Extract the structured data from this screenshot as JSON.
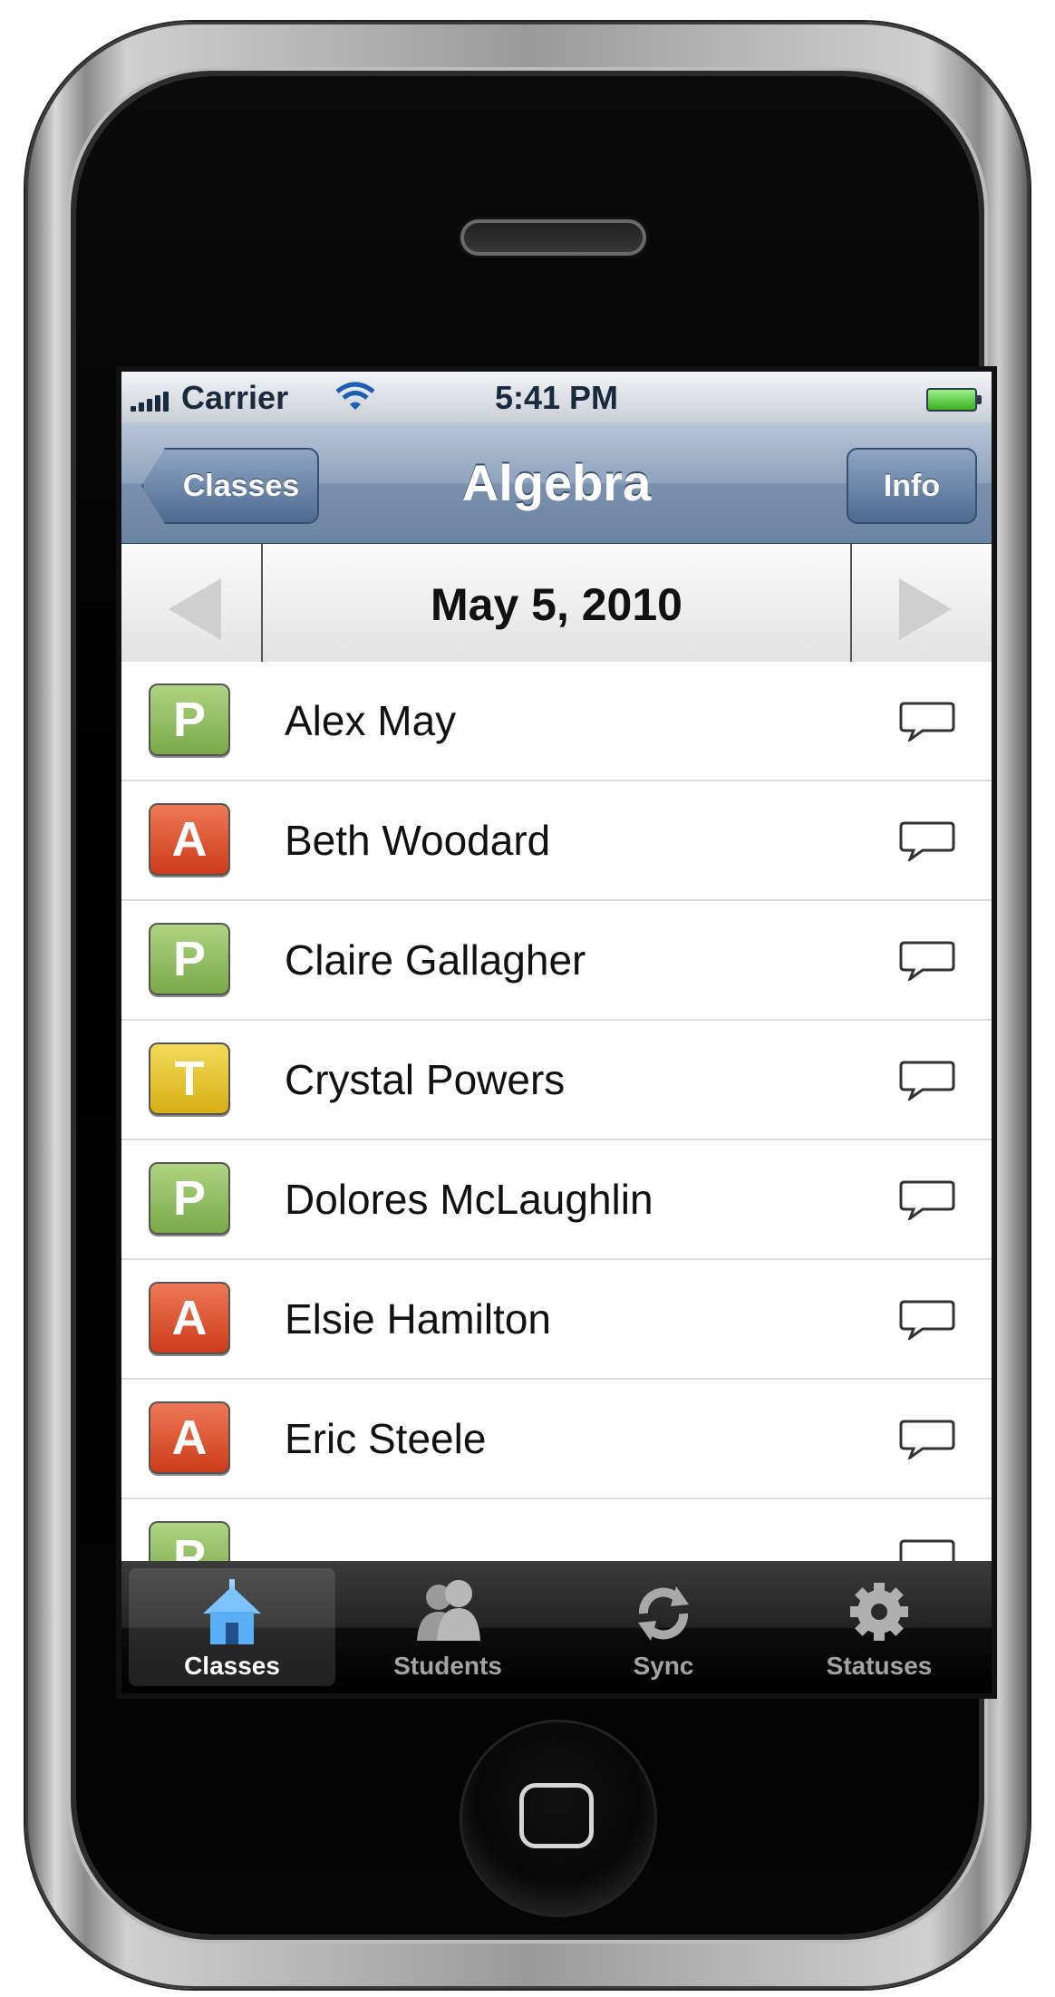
{
  "statusbar": {
    "carrier": "Carrier",
    "time": "5:41 PM"
  },
  "navbar": {
    "back_label": "Classes",
    "title": "Algebra",
    "info_label": "Info"
  },
  "datebar": {
    "date": "May 5, 2010"
  },
  "students": [
    {
      "status": "P",
      "name": "Alex May"
    },
    {
      "status": "A",
      "name": "Beth Woodard"
    },
    {
      "status": "P",
      "name": "Claire Gallagher"
    },
    {
      "status": "T",
      "name": "Crystal Powers"
    },
    {
      "status": "P",
      "name": "Dolores McLaughlin"
    },
    {
      "status": "A",
      "name": "Elsie Hamilton"
    },
    {
      "status": "A",
      "name": "Eric Steele"
    },
    {
      "status": "P",
      "name": ""
    }
  ],
  "tabs": [
    {
      "label": "Classes",
      "icon": "schoolhouse-icon",
      "active": true
    },
    {
      "label": "Students",
      "icon": "people-icon",
      "active": false
    },
    {
      "label": "Sync",
      "icon": "sync-icon",
      "active": false
    },
    {
      "label": "Statuses",
      "icon": "gear-icon",
      "active": false
    }
  ],
  "colors": {
    "present": "#8dbc5a",
    "absent": "#dd5030",
    "tardy": "#e6c52c",
    "navbar": "#8fa3bd"
  }
}
